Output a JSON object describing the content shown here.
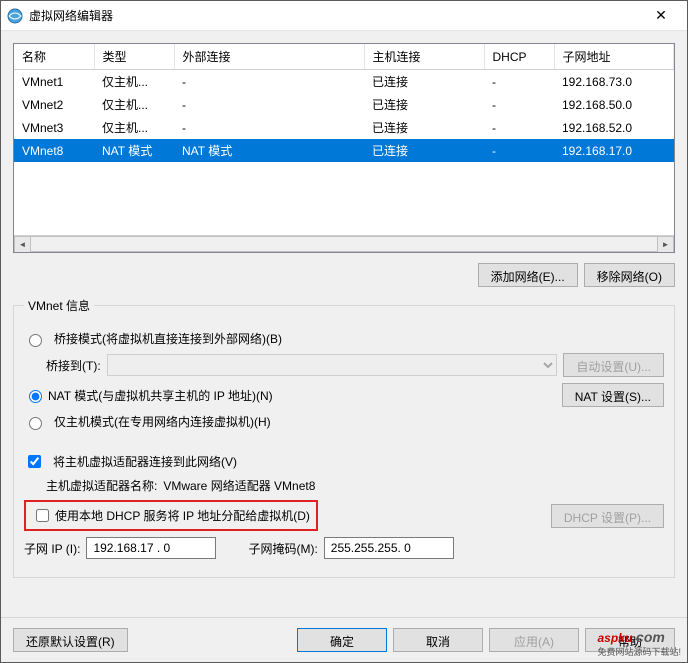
{
  "title": "虚拟网络编辑器",
  "columns": [
    "名称",
    "类型",
    "外部连接",
    "主机连接",
    "DHCP",
    "子网地址"
  ],
  "rows": [
    {
      "name": "VMnet1",
      "type": "仅主机...",
      "ext": "-",
      "host": "已连接",
      "dhcp": "-",
      "subnet": "192.168.73.0",
      "sel": false
    },
    {
      "name": "VMnet2",
      "type": "仅主机...",
      "ext": "-",
      "host": "已连接",
      "dhcp": "-",
      "subnet": "192.168.50.0",
      "sel": false
    },
    {
      "name": "VMnet3",
      "type": "仅主机...",
      "ext": "-",
      "host": "已连接",
      "dhcp": "-",
      "subnet": "192.168.52.0",
      "sel": false
    },
    {
      "name": "VMnet8",
      "type": "NAT 模式",
      "ext": "NAT 模式",
      "host": "已连接",
      "dhcp": "-",
      "subnet": "192.168.17.0",
      "sel": true
    }
  ],
  "buttons": {
    "add_network": "添加网络(E)...",
    "remove_network": "移除网络(O)",
    "auto_settings": "自动设置(U)...",
    "nat_settings": "NAT 设置(S)...",
    "dhcp_settings": "DHCP 设置(P)...",
    "restore": "还原默认设置(R)",
    "ok": "确定",
    "cancel": "取消",
    "apply": "应用(A)",
    "help": "帮助"
  },
  "groupbox_title": "VMnet 信息",
  "radio_bridged": "桥接模式(将虚拟机直接连接到外部网络)(B)",
  "bridged_to_label": "桥接到(T):",
  "radio_nat": "NAT 模式(与虚拟机共享主机的 IP 地址)(N)",
  "radio_hostonly": "仅主机模式(在专用网络内连接虚拟机)(H)",
  "chk_host_adapter": "将主机虚拟适配器连接到此网络(V)",
  "host_adapter_name_label": "主机虚拟适配器名称: ",
  "host_adapter_name_value": "VMware 网络适配器 VMnet8",
  "chk_dhcp": "使用本地 DHCP 服务将 IP 地址分配给虚拟机(D)",
  "subnet_ip_label": "子网 IP (I):",
  "subnet_ip_value": "192.168.17 . 0",
  "subnet_mask_label": "子网掩码(M):",
  "subnet_mask_value": "255.255.255. 0",
  "watermark": "aspku",
  "watermark_suffix": ".com",
  "watermark_sub": "免费网站源码下载站!"
}
